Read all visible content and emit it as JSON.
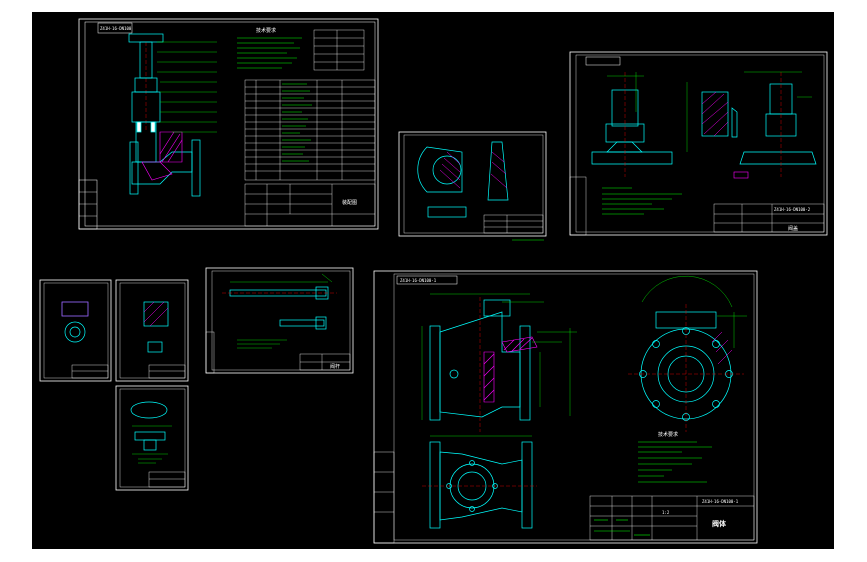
{
  "sheets": {
    "assembly": {
      "drawing_no": "Z41H-16-DN100",
      "assembly_label": "装配图",
      "tech_title": "技术要求"
    },
    "bonnet": {
      "drawing_no": "Z41H-16-DN100-2",
      "part_name": "阀盖"
    },
    "stem": {
      "part_name": "阀杆"
    },
    "body": {
      "drawing_no": "Z41H-16-DN100-1",
      "part_name": "阀体",
      "scale": "1:2",
      "tech_title": "技术要求"
    }
  },
  "colors": {
    "background": "#000000",
    "frame": "#ffffff",
    "geometry": "#00ffff",
    "dimension": "#00ff00",
    "hatch": "#ff00ff",
    "center": "#ff0000",
    "note": "#ffff00"
  }
}
